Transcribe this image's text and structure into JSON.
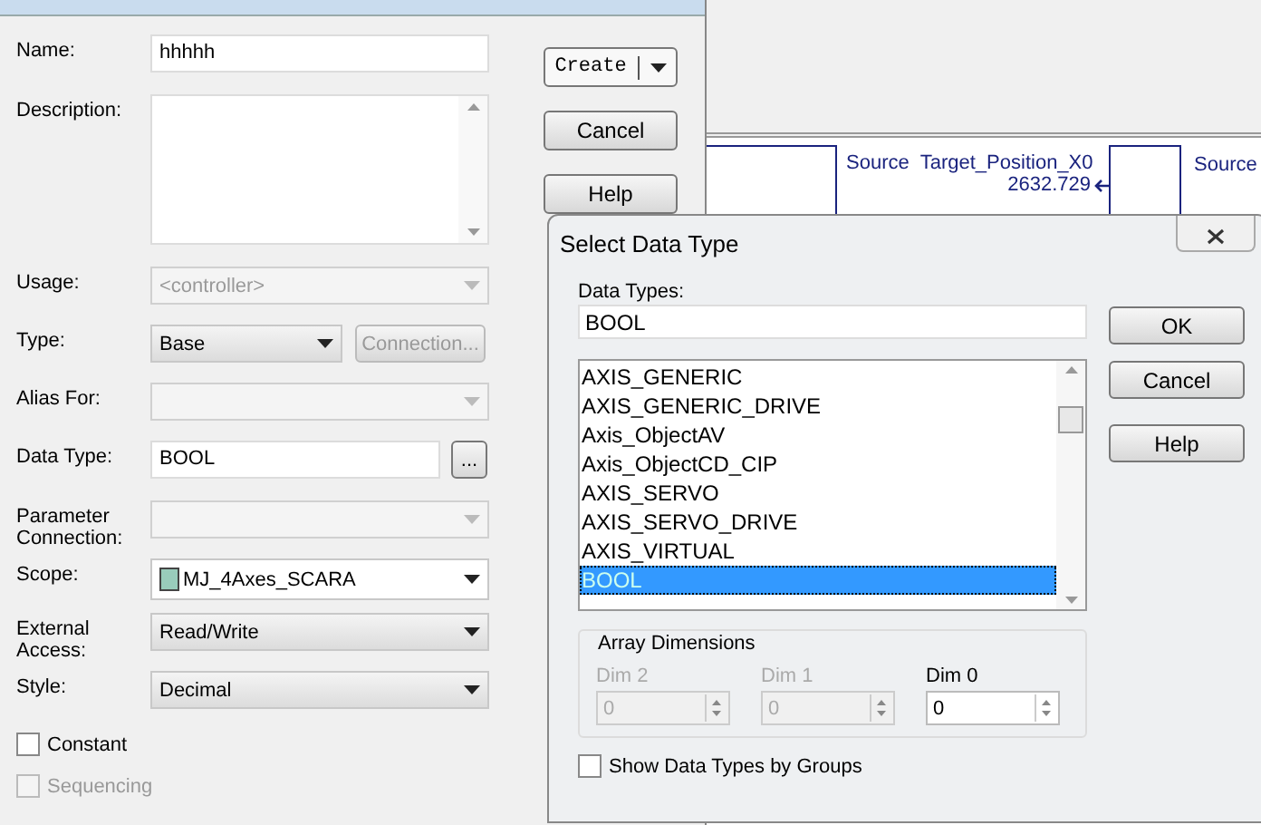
{
  "tag_dialog": {
    "fields": [
      {
        "kind": "text",
        "label": "Name:",
        "value": "hhhhh"
      },
      {
        "kind": "memo",
        "label": "Description:"
      },
      {
        "kind": "combo",
        "label": "Usage:",
        "value": "<controller>",
        "disabled": true
      },
      {
        "kind": "combo_button",
        "label": "Type:",
        "value": "Base",
        "disabled": false,
        "button": {
          "label": "Connection...",
          "disabled": true
        }
      },
      {
        "kind": "combo",
        "label": "Alias For:",
        "disabled": true
      },
      {
        "kind": "browse",
        "label": "Data Type:",
        "value": "BOOL",
        "button": "..."
      },
      {
        "kind": "combo",
        "label": "Parameter Connection:",
        "disabled": true
      },
      {
        "kind": "scope",
        "label": "Scope:",
        "value": "MJ_4Axes_SCARA"
      },
      {
        "kind": "combo",
        "label": "External Access:",
        "value": "Read/Write",
        "disabled": false
      },
      {
        "kind": "combo",
        "label": "Style:",
        "value": "Decimal",
        "disabled": false
      }
    ],
    "checkboxes": [
      {
        "label": "Constant",
        "checked": false,
        "disabled": false
      },
      {
        "label": "Sequencing",
        "checked": false,
        "disabled": true
      }
    ],
    "buttons": [
      {
        "label": "Create",
        "split": true
      },
      {
        "label": "Cancel",
        "split": false
      },
      {
        "label": "Help",
        "split": false
      }
    ]
  },
  "ladder": {
    "source_label": "Source",
    "tag": "Target_Position_X0",
    "value": "2632.729",
    "second_source_label": "Source"
  },
  "select_dialog": {
    "title": "Select Data Type",
    "search_label": "Data Types:",
    "search_value": "BOOL",
    "types": [
      {
        "label": "AXIS_GENERIC",
        "selected": false
      },
      {
        "label": "AXIS_GENERIC_DRIVE",
        "selected": false
      },
      {
        "label": "Axis_ObjectAV",
        "selected": false
      },
      {
        "label": "Axis_ObjectCD_CIP",
        "selected": false
      },
      {
        "label": "AXIS_SERVO",
        "selected": false
      },
      {
        "label": "AXIS_SERVO_DRIVE",
        "selected": false
      },
      {
        "label": "AXIS_VIRTUAL",
        "selected": false
      },
      {
        "label": "BOOL",
        "selected": true
      }
    ],
    "array_title": "Array Dimensions",
    "dims": [
      {
        "label": "Dim 2",
        "value": "0",
        "disabled": true
      },
      {
        "label": "Dim 1",
        "value": "0",
        "disabled": true
      },
      {
        "label": "Dim 0",
        "value": "0",
        "disabled": false
      }
    ],
    "group_checkbox": {
      "label": "Show Data Types by Groups",
      "checked": false
    },
    "buttons": [
      "OK",
      "Cancel",
      "Help"
    ]
  }
}
